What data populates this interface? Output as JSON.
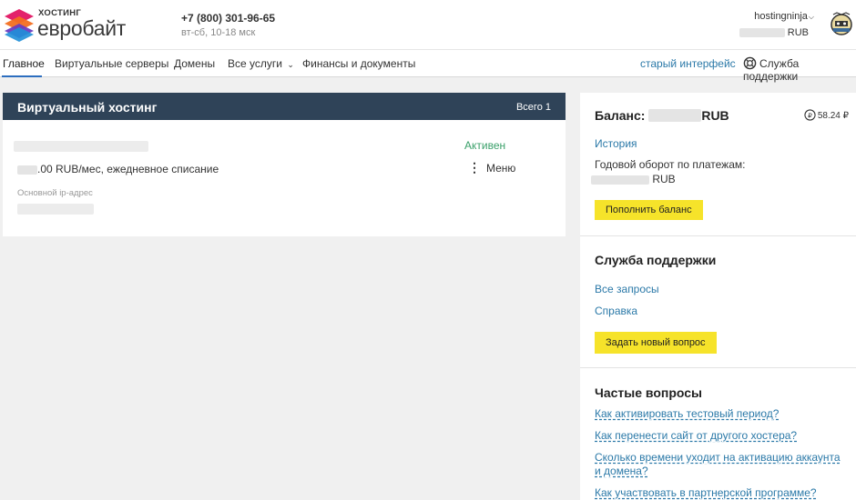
{
  "brand": {
    "top": "ХОСТИНГ",
    "name": "евробайт"
  },
  "contact": {
    "phone": "+7 (800) 301-96-65",
    "hours": "вт-сб, 10-18 мск"
  },
  "user": {
    "name": "hostingninja",
    "currency": "RUB"
  },
  "nav": {
    "items": [
      "Главное",
      "Виртуальные серверы",
      "Домены",
      "Все услуги",
      "Финансы и документы"
    ],
    "old_ui": "старый интерфейс",
    "support": "Служба поддержки"
  },
  "hosting": {
    "title": "Виртуальный хостинг",
    "total": "Всего 1",
    "status": "Активен",
    "price": ".00 RUB/мес, ежедневное списание",
    "menu": "Меню",
    "ip_label": "Основной ip-адрес"
  },
  "balance": {
    "title": "Баланс:",
    "currency": "RUB",
    "coins": "58.24 ₽",
    "history": "История",
    "turnover_label": "Годовой оборот по платежам:",
    "turnover_currency": "RUB",
    "topup": "Пополнить баланс"
  },
  "support_block": {
    "title": "Служба поддержки",
    "all_requests": "Все запросы",
    "help": "Справка",
    "new_request": "Задать новый вопрос"
  },
  "faq": {
    "title": "Частые вопросы",
    "items": [
      "Как активировать тестовый период?",
      "Как перенести сайт от другого хостера?",
      "Сколько времени уходит на активацию аккаунта и домена?",
      "Как участвовать в партнерской программе?"
    ]
  },
  "colors": {
    "accent": "#2b79a8",
    "header_dark": "#2f4358",
    "active": "#3aa06a",
    "button": "#f6e32a"
  }
}
